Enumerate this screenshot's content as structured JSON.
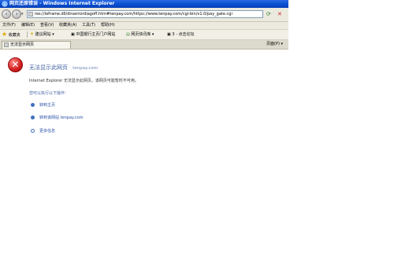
{
  "window": {
    "title": "网页还原错误 - Windows Internet Explorer"
  },
  "address_bar": {
    "url": "res://ieframe.dll/dnserrordiagoff.htm#tenpay.com/https://www.tenpay.com/cgi-bin/v1.0/pay_gate.cgi"
  },
  "menu": [
    "文件(F)",
    "编辑(E)",
    "查看(V)",
    "收藏夹(A)",
    "工具(T)",
    "帮助(H)"
  ],
  "favorites_bar": {
    "favorites_label": "收藏夹",
    "items": [
      "建议网站 ▾",
      "中国银行主页门户网站",
      "网页快讯库 ▾",
      "3 - 点击论坛"
    ]
  },
  "tab": {
    "label": "无法显示网页"
  },
  "tab_tools": [
    "页面(P) ▾"
  ],
  "error_page": {
    "heading": "无法显示此网页",
    "host": "tenpay.com",
    "message": "Internet Explorer 无法显示此网页。该网页可能暂时不可用。",
    "subheading": "您可以执行以下操作：",
    "options": [
      "转到主页",
      "转到该网站 tenpay.com",
      "更多信息"
    ]
  },
  "colors": {
    "title_bar": "#0a4fd0",
    "heading": "#3f5fa0",
    "link": "#2850a8",
    "error_icon": "#d21d1d"
  }
}
